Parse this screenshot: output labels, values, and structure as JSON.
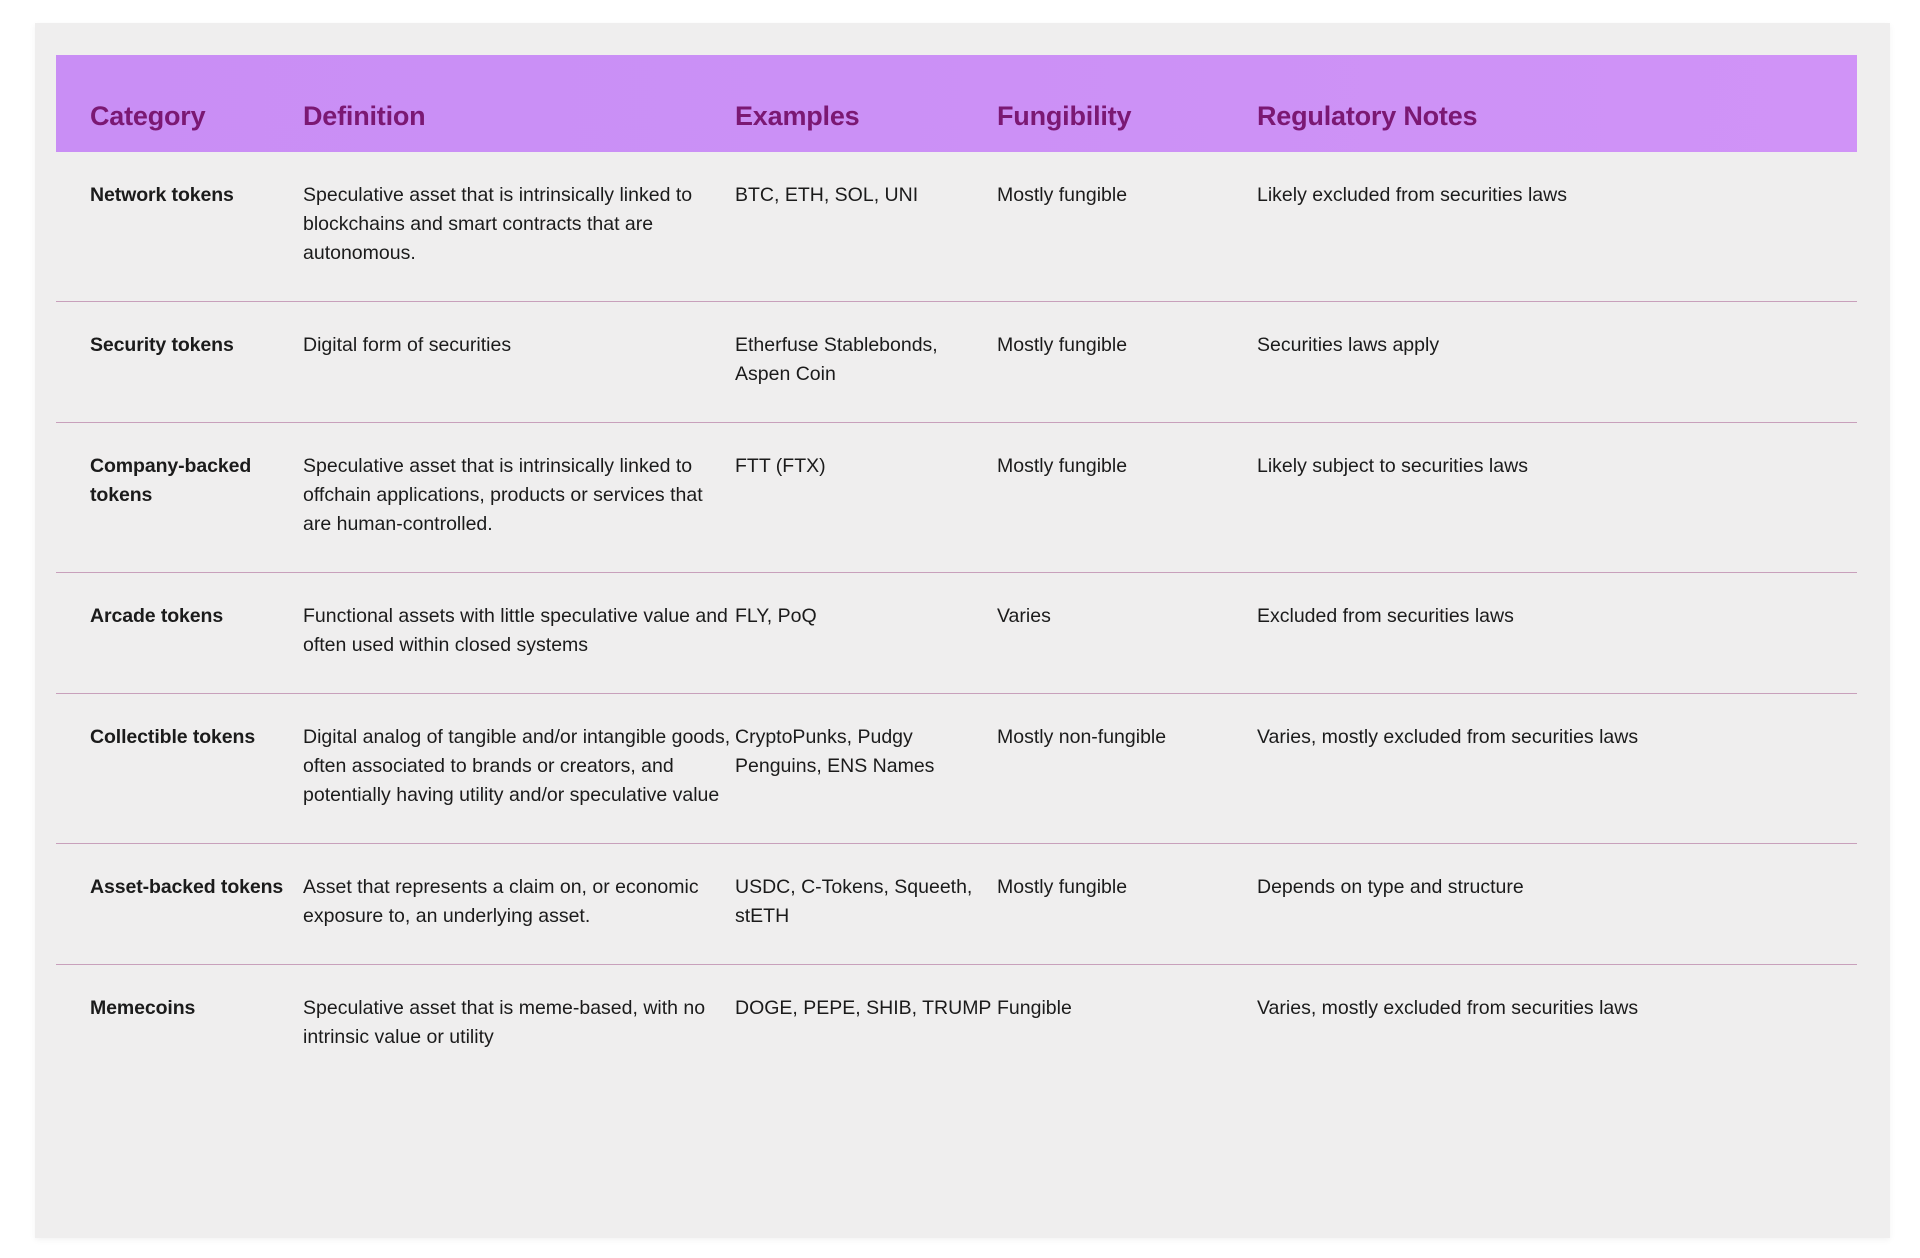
{
  "table": {
    "columns": [
      {
        "key": "category",
        "label": "Category"
      },
      {
        "key": "definition",
        "label": "Definition"
      },
      {
        "key": "examples",
        "label": "Examples"
      },
      {
        "key": "fungibility",
        "label": "Fungibility"
      },
      {
        "key": "regulatory",
        "label": "Regulatory Notes"
      }
    ],
    "rows": [
      {
        "category": "Network tokens",
        "definition": "Speculative asset that is intrinsically linked to blockchains and smart contracts that are autonomous.",
        "examples": "BTC, ETH, SOL, UNI",
        "fungibility": "Mostly fungible",
        "regulatory": "Likely excluded from securities laws"
      },
      {
        "category": "Security tokens",
        "definition": "Digital form of securities",
        "examples": "Etherfuse Stablebonds, Aspen Coin",
        "fungibility": "Mostly fungible",
        "regulatory": "Securities laws apply"
      },
      {
        "category": "Company-backed tokens",
        "definition": "Speculative asset that is intrinsically linked to offchain applications, products or services that are human-controlled.",
        "examples": "FTT (FTX)",
        "fungibility": "Mostly fungible",
        "regulatory": "Likely subject to securities laws"
      },
      {
        "category": "Arcade tokens",
        "definition": "Functional assets with little speculative value and often used within closed systems",
        "examples": "FLY, PoQ",
        "fungibility": "Varies",
        "regulatory": "Excluded from securities laws"
      },
      {
        "category": "Collectible tokens",
        "definition": "Digital analog of tangible and/or intangible goods, often associated to brands or creators, and potentially having utility and/or speculative value",
        "examples": "CryptoPunks, Pudgy Penguins, ENS Names",
        "fungibility": "Mostly non-fungible",
        "regulatory": "Varies, mostly excluded from securities laws"
      },
      {
        "category": "Asset-backed tokens",
        "definition": "Asset that represents a claim on, or economic exposure to, an underlying asset.",
        "examples": "USDC, C-Tokens, Squeeth, stETH",
        "fungibility": "Mostly fungible",
        "regulatory": "Depends on type and structure"
      },
      {
        "category": "Memecoins",
        "definition": "Speculative asset that is meme-based, with no intrinsic value or utility",
        "examples": "DOGE, PEPE, SHIB, TRUMP",
        "fungibility": "Fungible",
        "regulatory": "Varies, mostly excluded from securities laws"
      }
    ]
  },
  "colors": {
    "header_gradient_start": "#c98ef5",
    "header_gradient_end": "#d093f7",
    "header_text": "#7b1873",
    "card_background": "#efeeee",
    "page_background": "#ffffff",
    "row_divider": "#c8a0bb",
    "body_text": "#1b1b1b"
  }
}
